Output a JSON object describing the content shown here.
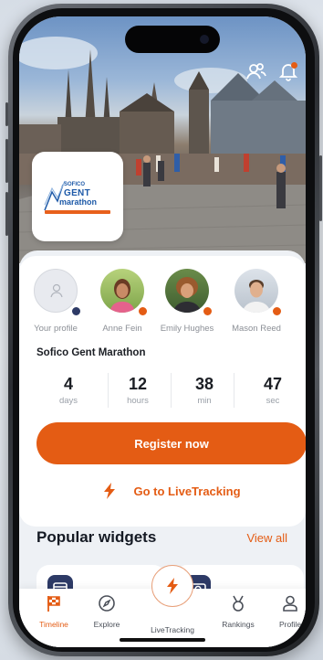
{
  "colors": {
    "accent": "#e45c14",
    "navy": "#2d3a66",
    "text": "#1b1e24",
    "muted": "#8b8f96"
  },
  "header": {
    "profile_icon": "users-icon",
    "notification_icon": "bell-icon"
  },
  "event": {
    "logo_line1": "SOFICO",
    "logo_line2": "GENT",
    "logo_line3": "marathon",
    "title": "Sofico Gent Marathon"
  },
  "friends": [
    {
      "name": "Your profile"
    },
    {
      "name": "Anne Fein"
    },
    {
      "name": "Emily Hughes"
    },
    {
      "name": "Mason Reed"
    }
  ],
  "countdown": [
    {
      "value": "4",
      "unit": "days"
    },
    {
      "value": "12",
      "unit": "hours"
    },
    {
      "value": "38",
      "unit": "min"
    },
    {
      "value": "47",
      "unit": "sec"
    }
  ],
  "actions": {
    "register": "Register now",
    "live_tracking": "Go to LiveTracking"
  },
  "widgets": {
    "title": "Popular widgets",
    "view_all": "View all",
    "items": [
      "calendar-icon",
      "camera-icon"
    ]
  },
  "tabs": [
    {
      "label": "Timeline",
      "icon": "flag-icon",
      "active": true
    },
    {
      "label": "Explore",
      "icon": "compass-icon",
      "active": false
    },
    {
      "label": "LiveTracking",
      "icon": "bolt-icon",
      "active": false
    },
    {
      "label": "Rankings",
      "icon": "medal-icon",
      "active": false
    },
    {
      "label": "Profile",
      "icon": "person-icon",
      "active": false
    }
  ]
}
